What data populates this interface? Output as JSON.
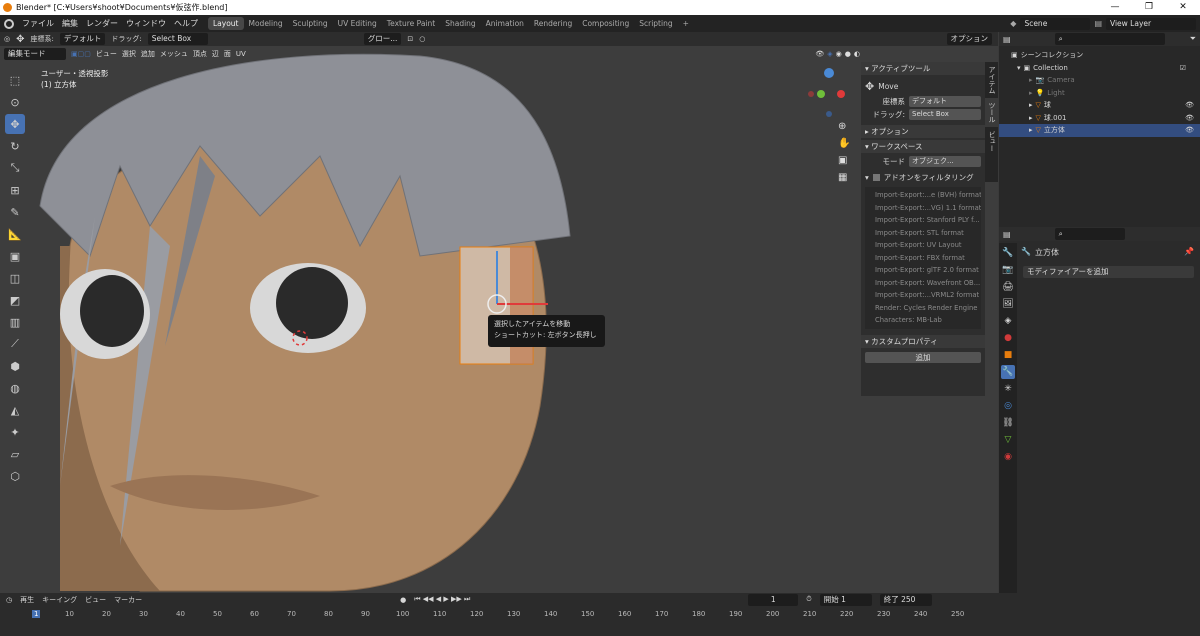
{
  "window": {
    "title": "Blender* [C:¥Users¥shoot¥Documents¥仮弦作.blend]",
    "min": "—",
    "max": "❐",
    "close": "✕"
  },
  "menu": [
    "ファイル",
    "編集",
    "レンダー",
    "ウィンドウ",
    "ヘルプ"
  ],
  "workspaces": [
    "Layout",
    "Modeling",
    "Sculpting",
    "UV Editing",
    "Texture Paint",
    "Shading",
    "Animation",
    "Rendering",
    "Compositing",
    "Scripting"
  ],
  "scene": {
    "name": "Scene",
    "view_layer": "View Layer"
  },
  "header": {
    "coord_label": "座標系:",
    "coord_value": "デフォルト",
    "drag_label": "ドラッグ:",
    "drag_value": "Select Box",
    "orient": "グロー...",
    "options": "オプション"
  },
  "header2": {
    "mode": "編集モード",
    "view": "ビュー",
    "select": "選択",
    "add": "追加",
    "mesh": "メッシュ",
    "vertex": "頂点",
    "edge": "辺",
    "face": "面",
    "uv": "UV"
  },
  "viewport": {
    "view_name": "ユーザー・透視投影",
    "object": "(1) 立方体"
  },
  "tooltip": {
    "line1": "選択したアイテムを移動",
    "line2": "ショートカット: 左ボタン長押し"
  },
  "npanel": {
    "active_tool": "アクティブツール",
    "tool_name": "Move",
    "coord_label": "座標系",
    "coord_value": "デフォルト",
    "drag_label": "ドラッグ:",
    "drag_value": "Select Box",
    "options": "オプション",
    "workspace": "ワークスペース",
    "mode_label": "モード",
    "mode_value": "オブジェク...",
    "addon_filter": "アドオンをフィルタリング",
    "addons": [
      "Import-Export:...e (BVH) format",
      "Import-Export:...VG) 1.1 format",
      "Import-Export: Stanford PLY f...",
      "Import-Export: STL format",
      "Import-Export: UV Layout",
      "Import-Export: FBX format",
      "Import-Export: glTF 2.0 format",
      "Import-Export: Wavefront OB...",
      "Import-Export:...VRML2 format",
      "Render: Cycles Render Engine",
      "Characters: MB-Lab"
    ],
    "custom_props": "カスタムプロパティ",
    "add_btn": "追加"
  },
  "sidebar_tabs": [
    "アイテム",
    "ツール",
    "ビュー"
  ],
  "outliner": {
    "scene_collection": "シーンコレクション",
    "items": [
      {
        "name": "Collection",
        "indent": 1,
        "selected": false
      },
      {
        "name": "Camera",
        "indent": 2,
        "selected": false
      },
      {
        "name": "Light",
        "indent": 2,
        "selected": false
      },
      {
        "name": "球",
        "indent": 2,
        "selected": false
      },
      {
        "name": "球.001",
        "indent": 2,
        "selected": false
      },
      {
        "name": "立方体",
        "indent": 2,
        "selected": true
      }
    ]
  },
  "properties": {
    "object": "立方体",
    "add_modifier": "モディファイアーを追加"
  },
  "timeline": {
    "play": "再生",
    "keying": "キーイング",
    "view": "ビュー",
    "marker": "マーカー",
    "current_frame": "1",
    "start_label": "開始",
    "start": "1",
    "end_label": "終了",
    "end": "250",
    "ticks": [
      "1",
      "10",
      "20",
      "30",
      "40",
      "50",
      "60",
      "70",
      "80",
      "90",
      "100",
      "110",
      "120",
      "130",
      "140",
      "150",
      "160",
      "170",
      "180",
      "190",
      "200",
      "210",
      "220",
      "230",
      "240",
      "250"
    ]
  },
  "colors": {
    "accent": "#4772b3",
    "skin": "#b08a66",
    "hair": "#8e9097",
    "select_orange": "#e87d0d"
  }
}
